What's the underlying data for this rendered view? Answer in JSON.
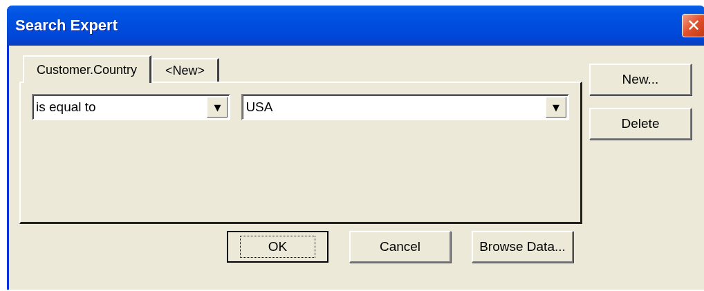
{
  "window": {
    "title": "Search Expert",
    "close": "✕"
  },
  "tabs": [
    {
      "label": "Customer.Country",
      "selected": true
    },
    {
      "label": "<New>",
      "selected": false
    }
  ],
  "condition": {
    "operator": "is equal to",
    "value": "USA",
    "arrow": "▼"
  },
  "side_buttons": [
    {
      "label": "New..."
    },
    {
      "label": "Delete"
    }
  ],
  "bottom_buttons": [
    {
      "label": "OK",
      "default": true
    },
    {
      "label": "Cancel",
      "default": false
    },
    {
      "label": "Browse Data...",
      "default": false
    }
  ]
}
